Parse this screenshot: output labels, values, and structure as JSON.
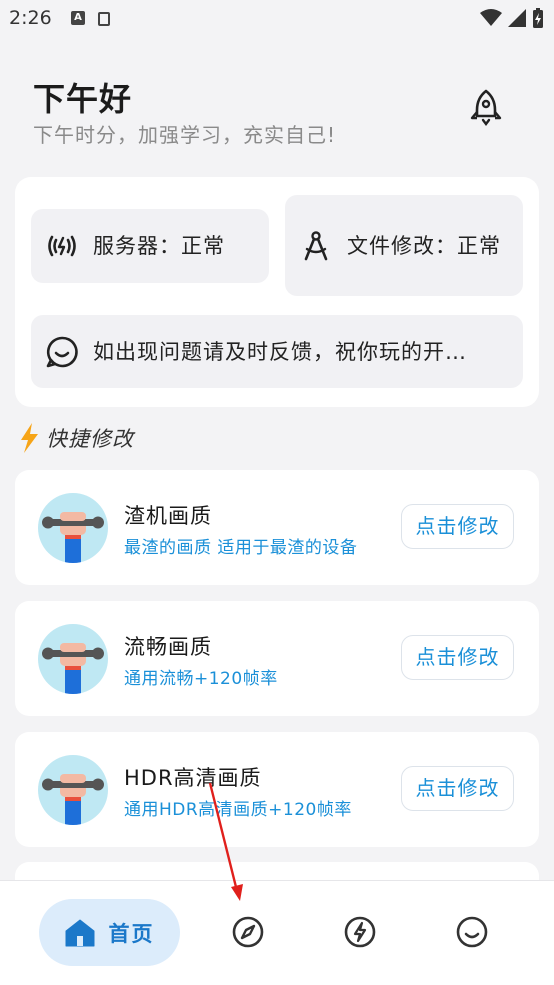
{
  "status": {
    "time": "2:26"
  },
  "header": {
    "greeting": "下午好",
    "subtitle": "下午时分，加强学习，充实自己!"
  },
  "status_card": {
    "server": "服务器：正常",
    "file_mod": "文件修改：正常",
    "feedback": "如出现问题请及时反馈，祝你玩的开…"
  },
  "quick": {
    "title": "快捷修改",
    "items": [
      {
        "name": "渣机画质",
        "desc": "最渣的画质 适用于最渣的设备",
        "button": "点击修改"
      },
      {
        "name": "流畅画质",
        "desc": "通用流畅+120帧率",
        "button": "点击修改"
      },
      {
        "name": "HDR高清画质",
        "desc": "通用HDR高清画质+120帧率",
        "button": "点击修改"
      }
    ]
  },
  "nav": {
    "home_label": "首页"
  },
  "colors": {
    "accent": "#1b90d8",
    "nav_active_bg": "#dcecfb",
    "lightning": "#f6a417"
  }
}
